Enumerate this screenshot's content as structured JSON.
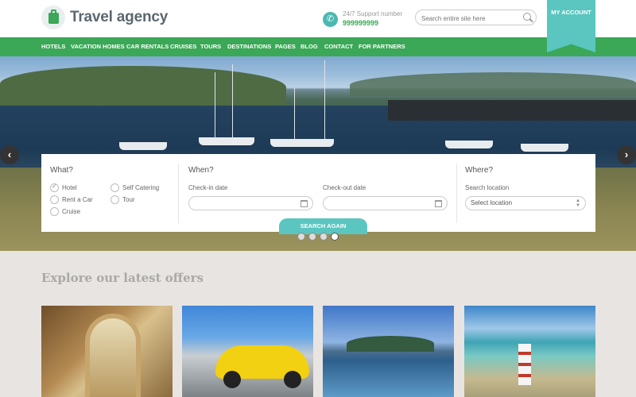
{
  "brand": {
    "name": "Travel agency"
  },
  "support": {
    "label": "24/7 Support number",
    "number": "999999999"
  },
  "search": {
    "placeholder": "Search entire site here"
  },
  "account": {
    "label": "MY ACCOUNT"
  },
  "nav": {
    "items": [
      "HOTELS",
      "VACATION HOMES",
      "CAR RENTALS",
      "CRUISES",
      "TOURS",
      "DESTINATIONS",
      "PAGES",
      "BLOG",
      "CONTACT",
      "FOR PARTNERS"
    ]
  },
  "searchPanel": {
    "what": {
      "title": "What?",
      "options": [
        {
          "label": "Hotel",
          "checked": true
        },
        {
          "label": "Self Catering",
          "checked": false
        },
        {
          "label": "Rent a Car",
          "checked": false
        },
        {
          "label": "Tour",
          "checked": false
        },
        {
          "label": "Cruise",
          "checked": false
        }
      ]
    },
    "when": {
      "title": "When?",
      "checkin_label": "Check-in date",
      "checkout_label": "Check-out date"
    },
    "where": {
      "title": "Where?",
      "location_label": "Search location",
      "location_select": "Select location"
    },
    "button": "SEARCH AGAIN"
  },
  "slider": {
    "dots": 4,
    "active_dot": 4
  },
  "offers": {
    "title": "Explore our latest offers",
    "items": [
      "hotel-corridor",
      "yellow-sports-car",
      "cruise-ship",
      "lighthouse-beach"
    ]
  }
}
